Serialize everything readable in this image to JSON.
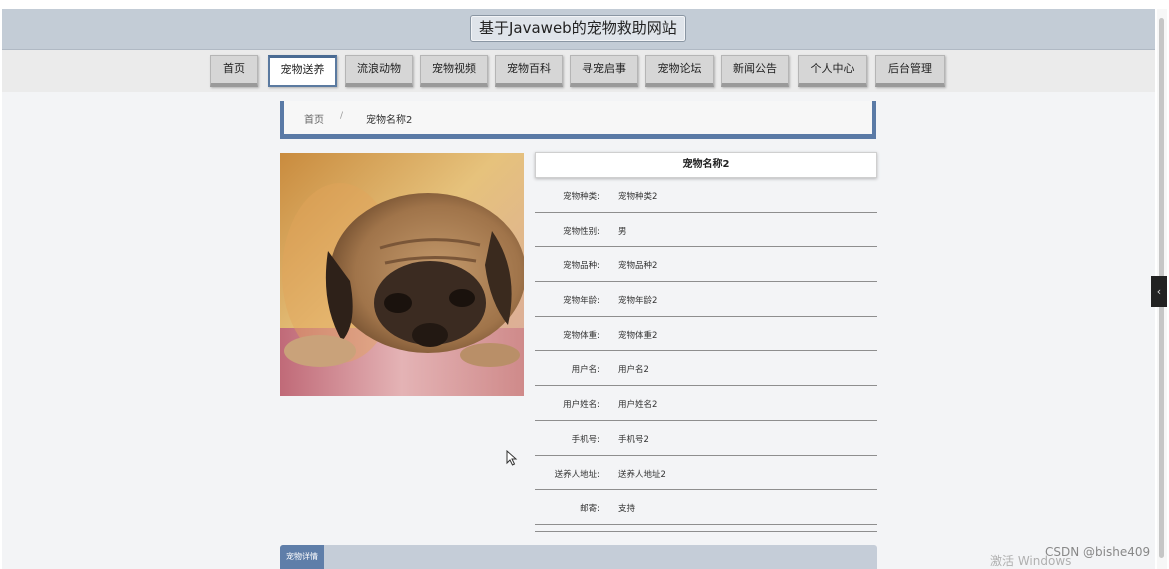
{
  "site": {
    "title": "基于Javaweb的宠物救助网站"
  },
  "nav": [
    {
      "label": "首页"
    },
    {
      "label": "宠物送养"
    },
    {
      "label": "流浪动物"
    },
    {
      "label": "宠物视频"
    },
    {
      "label": "宠物百科"
    },
    {
      "label": "寻宠启事"
    },
    {
      "label": "宠物论坛"
    },
    {
      "label": "新闻公告"
    },
    {
      "label": "个人中心"
    },
    {
      "label": "后台管理"
    }
  ],
  "breadcrumb": {
    "home": "首页",
    "separator": "/",
    "current": "宠物名称2"
  },
  "detail": {
    "title": "宠物名称2",
    "fields": [
      {
        "label": "宠物种类:",
        "value": "宠物种类2"
      },
      {
        "label": "宠物性别:",
        "value": "男"
      },
      {
        "label": "宠物品种:",
        "value": "宠物品种2"
      },
      {
        "label": "宠物年龄:",
        "value": "宠物年龄2"
      },
      {
        "label": "宠物体重:",
        "value": "宠物体重2"
      },
      {
        "label": "用户名:",
        "value": "用户名2"
      },
      {
        "label": "用户姓名:",
        "value": "用户姓名2"
      },
      {
        "label": "手机号:",
        "value": "手机号2"
      },
      {
        "label": "送养人地址:",
        "value": "送养人地址2"
      },
      {
        "label": "邮寄:",
        "value": "支持"
      }
    ]
  },
  "section": {
    "tab_label": "宠物详情"
  },
  "overlay": {
    "activate_text": "激活 Windows",
    "watermark": "CSDN @bishe409",
    "side_toggle": "‹"
  },
  "colors": {
    "accent": "#5a7aa6",
    "header_bg": "#c3ccd6"
  }
}
